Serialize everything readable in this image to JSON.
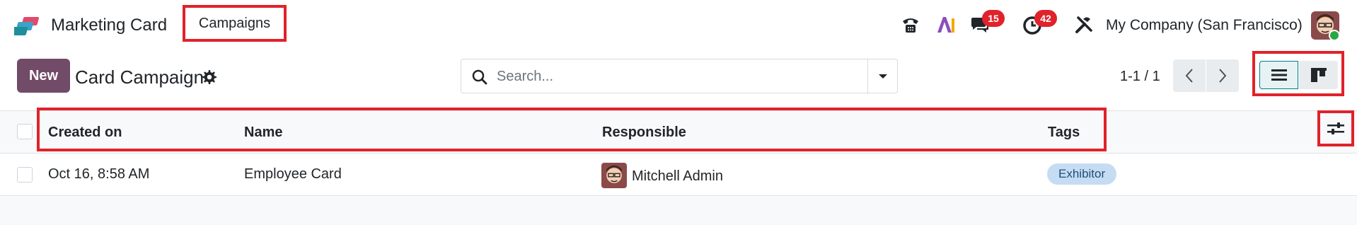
{
  "navbar": {
    "app_name": "Marketing Card",
    "menu_item": "Campaigns",
    "icons": [
      "phone-icon",
      "ai-icon",
      "chat-icon",
      "activity-clock-icon",
      "debug-tools-icon"
    ],
    "messages_badge": "15",
    "activities_badge": "42",
    "company": "My Company (San Francisco)"
  },
  "control_panel": {
    "new_label": "New",
    "title": "Card Campaign",
    "search_placeholder": "Search...",
    "pager": "1-1 / 1"
  },
  "table": {
    "columns": [
      "Created on",
      "Name",
      "Responsible",
      "Tags"
    ],
    "rows": [
      {
        "created_on": "Oct 16, 8:58 AM",
        "name": "Employee Card",
        "responsible": "Mitchell Admin",
        "tag": "Exhibitor"
      }
    ]
  },
  "colors": {
    "brand": "#714b67",
    "highlight": "#e0222a",
    "badge": "#e0222a",
    "tag_bg": "#c5dcf3"
  }
}
